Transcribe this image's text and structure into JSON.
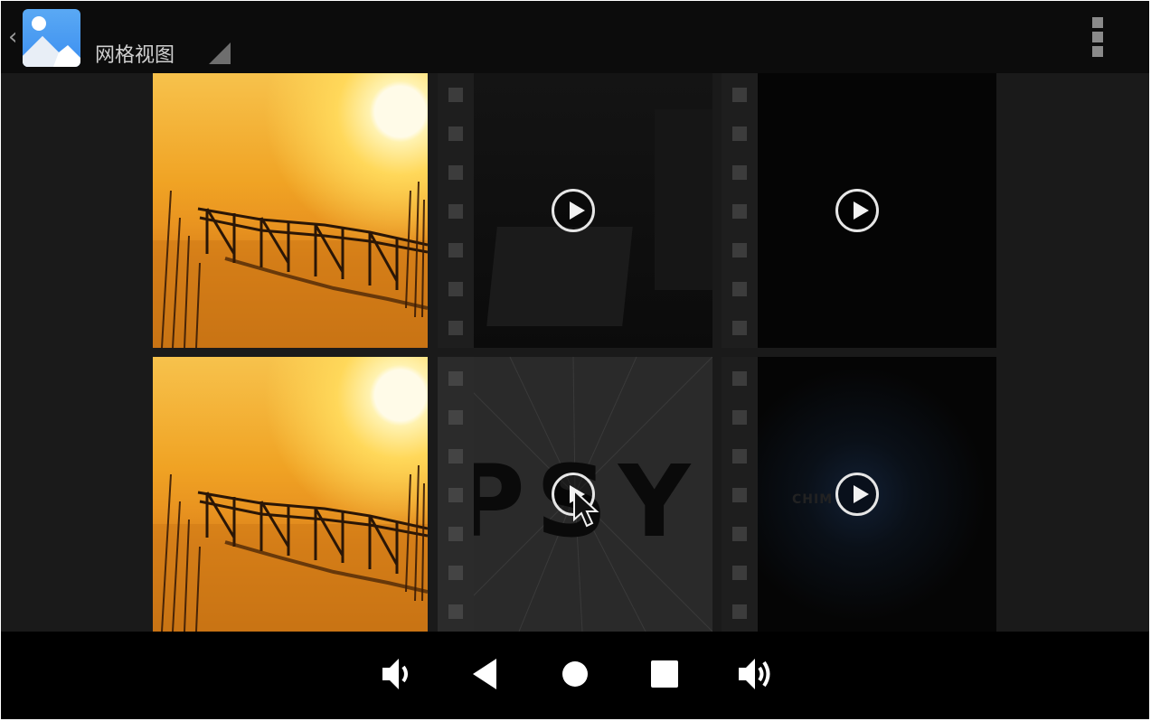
{
  "action_bar": {
    "title": "网格视图",
    "app_icon": "gallery-photo-icon",
    "overflow_icon": "overflow-menu-icon"
  },
  "grid": {
    "items": [
      {
        "type": "photo",
        "subject": "sunset-pier"
      },
      {
        "type": "video",
        "overlay": "play-icon"
      },
      {
        "type": "video",
        "overlay": "play-icon"
      },
      {
        "type": "photo",
        "subject": "sunset-pier"
      },
      {
        "type": "video",
        "overlay": "play-icon",
        "visible_text": "PSY"
      },
      {
        "type": "video",
        "overlay": "play-icon",
        "visible_text": "CHIM"
      }
    ]
  },
  "nav_bar": {
    "buttons": [
      "volume-down-icon",
      "back-icon",
      "home-icon",
      "recents-icon",
      "volume-up-icon"
    ]
  },
  "colors": {
    "action_bar_bg": "#0c0c0c",
    "grid_bg": "#1a1a1a",
    "nav_bar_bg": "#000000",
    "app_icon_blue": "#3b8ef0"
  }
}
